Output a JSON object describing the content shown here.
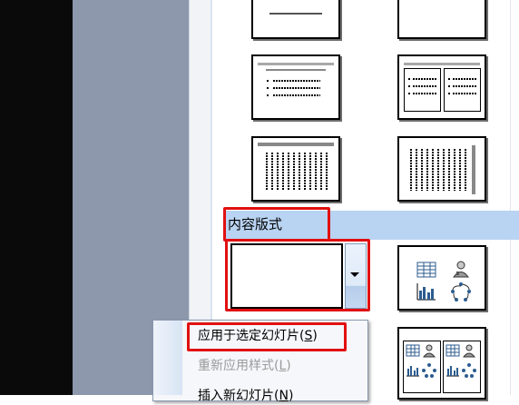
{
  "section_header": {
    "label": "内容版式"
  },
  "menu": {
    "items": [
      {
        "text": "应用于选定幻灯片(",
        "key": "S",
        "close": ")",
        "enabled": true
      },
      {
        "text": "重新应用样式(",
        "key": "L",
        "close": ")",
        "enabled": false
      },
      {
        "text": "插入新幻灯片(",
        "key": "N",
        "close": ")",
        "enabled": true
      }
    ]
  },
  "icons": {
    "dropdown": "chevron-down-icon",
    "table": "table-icon",
    "person": "person-icon",
    "chart": "bar-chart-icon",
    "diagram": "diagram-icon"
  },
  "colors": {
    "highlight_red": "#e11010",
    "section_header_bg": "#b9d3f2",
    "slate": "#8d98ad"
  }
}
